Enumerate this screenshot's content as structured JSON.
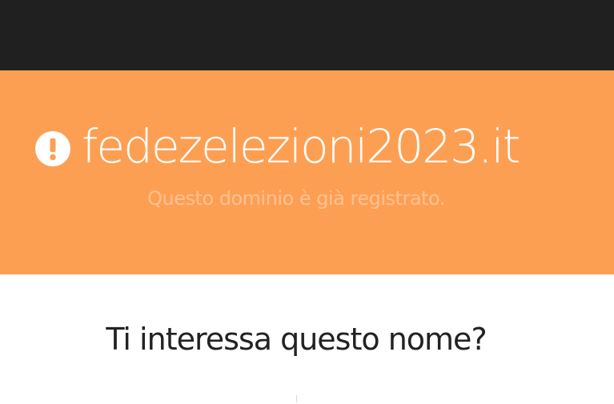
{
  "header": {
    "domain": "fedezelezioni2023.it",
    "status": "Questo dominio è già registrato.",
    "icon": "exclamation-circle-icon",
    "colors": {
      "topbar": "#202020",
      "hero": "#fd9f53",
      "status_text": "#fdc293"
    }
  },
  "main": {
    "heading": "Ti interessa questo nome?"
  }
}
